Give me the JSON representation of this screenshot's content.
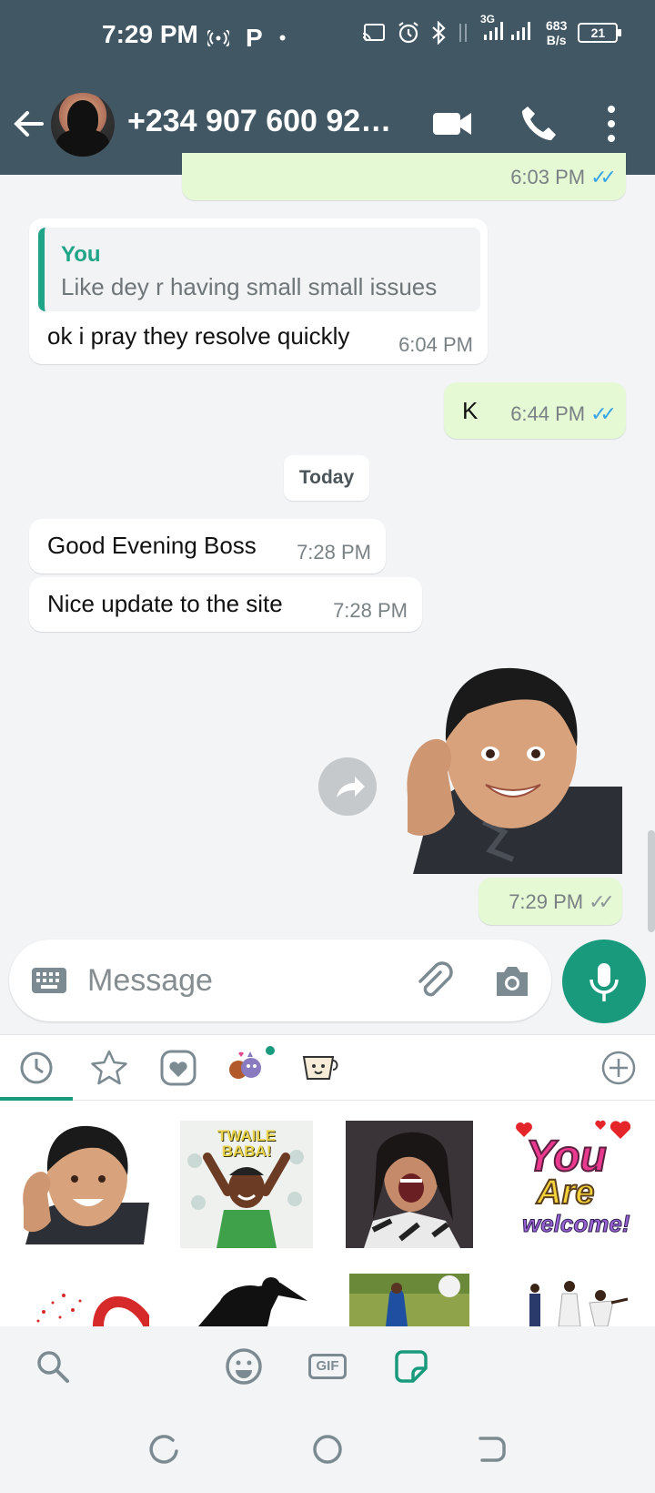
{
  "status_bar": {
    "time": "7:29 PM",
    "carrier_icon": "P",
    "dot": "•",
    "network_type": "3G",
    "net_speed_value": "683",
    "net_speed_unit": "B/s",
    "battery": "21"
  },
  "header": {
    "contact": "+234 907 600 92…"
  },
  "messages": {
    "top_time": "6:03 PM",
    "reply": {
      "quoted_author": "You",
      "quoted_text": "Like dey r having small small issues",
      "text": "ok i pray they resolve quickly",
      "time": "6:04 PM"
    },
    "k": {
      "text": "K",
      "time": "6:44 PM"
    },
    "date_divider": "Today",
    "greeting": {
      "text": "Good Evening Boss",
      "time": "7:28 PM"
    },
    "update": {
      "text": "Nice update to the site",
      "time": "7:28 PM"
    },
    "sticker": {
      "time": "7:29 PM"
    }
  },
  "composer": {
    "placeholder": "Message"
  },
  "sticker_tray": {
    "gif_label": "GIF",
    "sticker_texts": {
      "twaile": "TWAILE BABA!",
      "welcome_1": "You",
      "welcome_2": "Are",
      "welcome_3": "welcome!"
    }
  },
  "colors": {
    "header": "#425764",
    "accent": "#1a9a7c",
    "outgoing_bubble": "#e4f9d4",
    "read_ticks": "#35a5e6"
  }
}
